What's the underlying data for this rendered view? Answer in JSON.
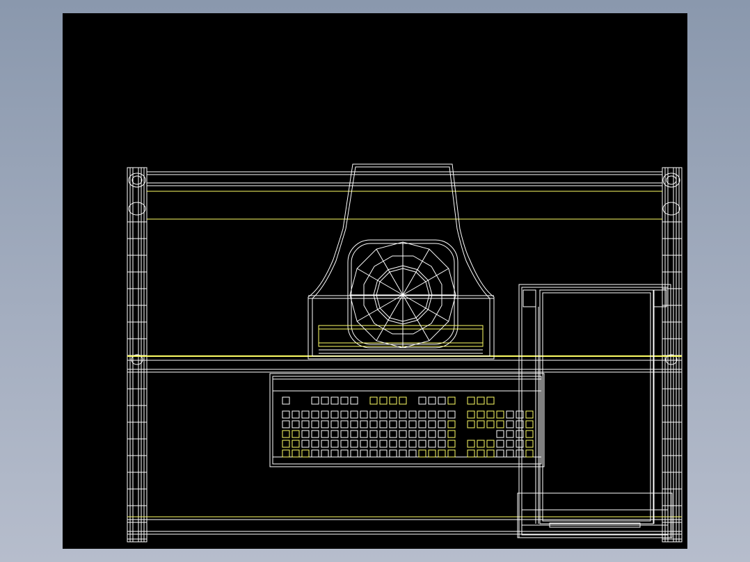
{
  "drawing": {
    "subject": "desk-with-monitor-keyboard-and-tower",
    "colors": {
      "background": "#000000",
      "line_primary": "#ffffff",
      "line_accent": "#ffff66",
      "viewport_border": "#8a98ad"
    }
  }
}
